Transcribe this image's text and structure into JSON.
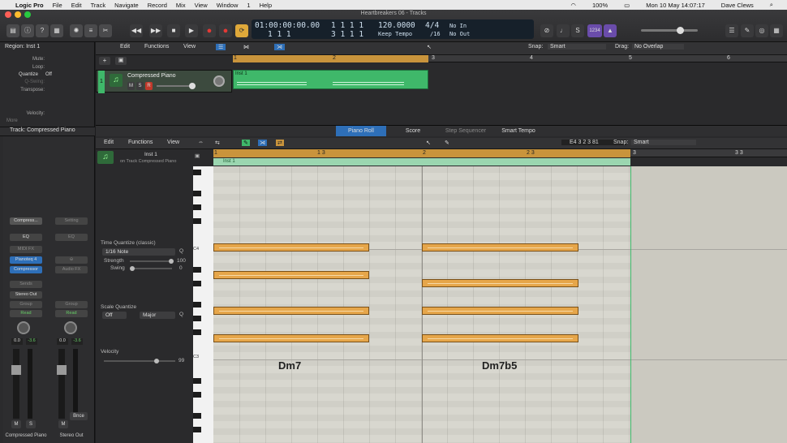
{
  "menubar": {
    "apple": "",
    "app": "Logic Pro",
    "items": [
      "File",
      "Edit",
      "Track",
      "Navigate",
      "Record",
      "Mix",
      "View",
      "Window",
      "1",
      "Help"
    ],
    "battery": "100%",
    "datetime": "Mon 10 May  14:07:17",
    "user": "Dave Clews"
  },
  "window_title": "Heartbreakers 06 - Tracks",
  "lcd": {
    "time": "01:00:00:00.00",
    "beats_row1": "1 1 1   1",
    "bars": "1  1  1",
    "beats_row2": "3  1  1   1",
    "tempo": "120.0000",
    "keep_tempo": "Keep Tempo",
    "sig": "4/4",
    "div": "/16",
    "in": "No In",
    "out": "No Out",
    "count_in": "1234"
  },
  "inspector": {
    "region_header": "Region: Inst 1",
    "mute": "Mute:",
    "loop": "Loop:",
    "quantize": "Quantize",
    "quantize_val": "Off",
    "qswing": "Q-Swing:",
    "transpose": "Transpose:",
    "velocity": "Velocity:",
    "more": "More",
    "track_header": "Track: Compressed Piano"
  },
  "strip1": {
    "setting": "Compress...",
    "eq": "EQ",
    "midi_fx": "MIDI FX",
    "inst": "Pianoteq 4",
    "fx": "Compressor",
    "sends": "Sends",
    "out": "Stereo Out",
    "group": "Group",
    "read": "Read",
    "pan": "0.0",
    "vol": "-3.6",
    "m": "M",
    "s": "S",
    "name": "Compressed Piano"
  },
  "strip2": {
    "setting": "Setting",
    "eq": "EQ",
    "audio_fx": "Audio FX",
    "out": "",
    "group": "Group",
    "read": "Read",
    "pan": "0.0",
    "vol": "-3.6",
    "m": "M",
    "bnce": "Bnce",
    "name": "Stereo Out"
  },
  "tracks_area": {
    "edit": "Edit",
    "functions": "Functions",
    "view": "View",
    "snap_label": "Snap:",
    "snap": "Smart",
    "drag_label": "Drag:",
    "drag": "No Overlap",
    "track_num": "1",
    "track_name": "Compressed Piano",
    "m": "M",
    "s": "S",
    "r": "R",
    "region": "Inst 1",
    "ruler": [
      "1",
      "2",
      "3",
      "4",
      "5",
      "6"
    ]
  },
  "piano_roll": {
    "tabs": [
      "Piano Roll",
      "Score",
      "Step Sequencer",
      "Smart Tempo"
    ],
    "edit": "Edit",
    "functions": "Functions",
    "view": "View",
    "position": "E4  3 2 3 81",
    "snap_label": "Snap:",
    "snap": "Smart",
    "region_name": "Inst 1",
    "region_sub": "on Track Compressed Piano",
    "region_bar": "Inst 1",
    "ruler": [
      "1",
      "1 3",
      "2",
      "2 3",
      "3",
      "3 3"
    ],
    "tq_label": "Time Quantize (classic)",
    "tq_value": "1/16 Note",
    "q": "Q",
    "strength_label": "Strength",
    "strength": "100",
    "swing_label": "Swing",
    "swing": "0",
    "sq_label": "Scale Quantize",
    "sq_off": "Off",
    "sq_major": "Major",
    "vel_label": "Velocity",
    "vel": "99",
    "c4": "C4",
    "c3": "C3",
    "chords": [
      "Dm7",
      "Dm7b5"
    ]
  },
  "colors": {
    "region_green": "#3fb86a",
    "note_orange": "#e6a64a",
    "ruler_gold": "#c9943c",
    "accent_blue": "#2e6fb8"
  }
}
